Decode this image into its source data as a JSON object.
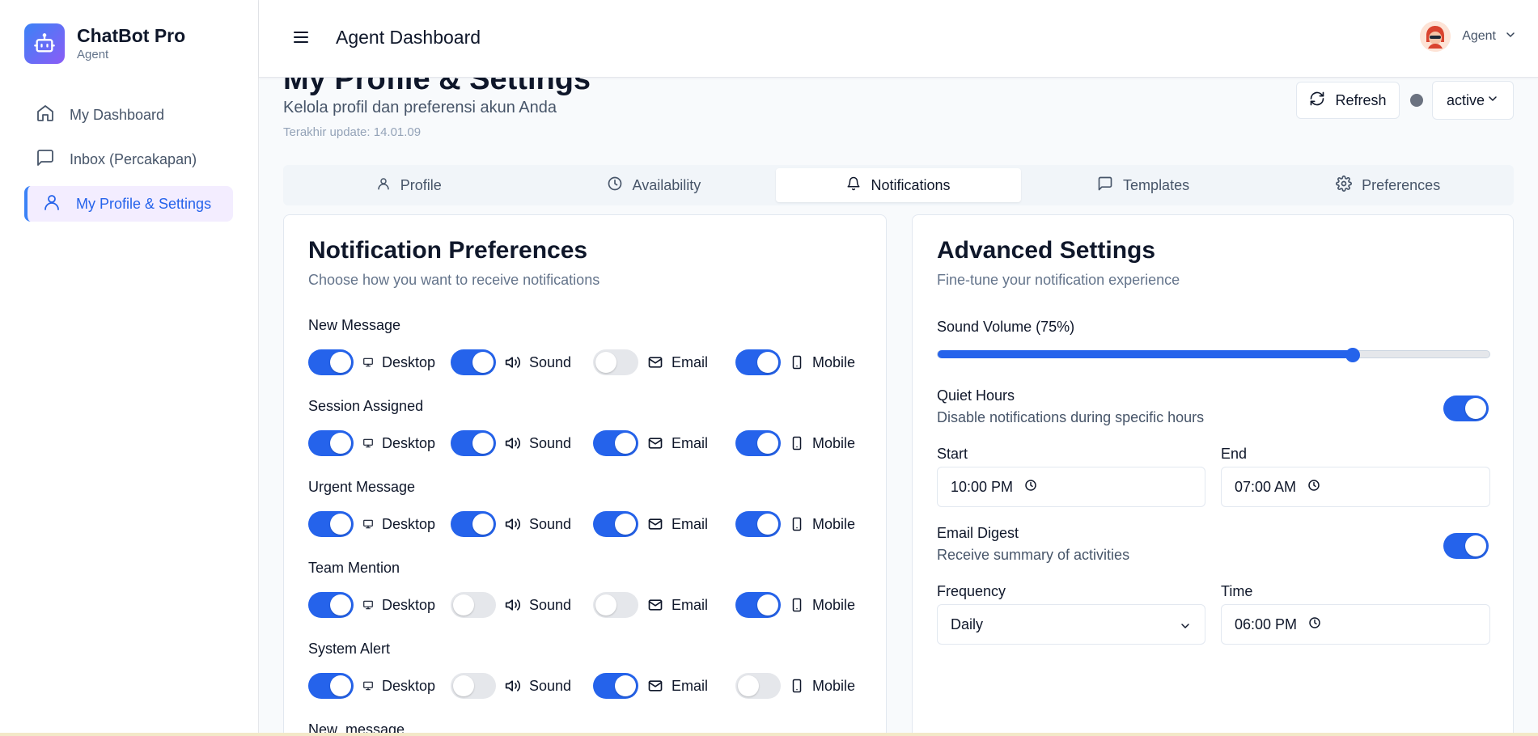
{
  "brand": {
    "name": "ChatBot Pro",
    "role": "Agent"
  },
  "sidebar": {
    "items": [
      {
        "label": "My Dashboard",
        "icon": "home-icon"
      },
      {
        "label": "Inbox (Percakapan)",
        "icon": "chat-bubble-icon"
      },
      {
        "label": "My Profile & Settings",
        "icon": "user-icon",
        "active": true
      }
    ]
  },
  "header": {
    "title": "Agent Dashboard",
    "user_name": "Agent"
  },
  "page": {
    "title": "My Profile & Settings",
    "subtitle": "Kelola profil dan preferensi akun Anda",
    "updated": "Terakhir update: 14.01.09",
    "refresh_label": "Refresh",
    "status_value": "active",
    "status_dot_color": "#6b7280"
  },
  "tabs": [
    {
      "label": "Profile",
      "icon": "user-icon"
    },
    {
      "label": "Availability",
      "icon": "clock-icon"
    },
    {
      "label": "Notifications",
      "icon": "bell-icon",
      "active": true
    },
    {
      "label": "Templates",
      "icon": "chat-bubble-icon"
    },
    {
      "label": "Preferences",
      "icon": "gear-icon"
    }
  ],
  "notifications": {
    "title": "Notification Preferences",
    "subtitle": "Choose how you want to receive notifications",
    "channels": {
      "desktop": "Desktop",
      "sound": "Sound",
      "email": "Email",
      "mobile": "Mobile"
    },
    "groups": [
      {
        "label": "New Message",
        "desktop": true,
        "sound": true,
        "email": false,
        "mobile": true
      },
      {
        "label": "Session Assigned",
        "desktop": true,
        "sound": true,
        "email": true,
        "mobile": true
      },
      {
        "label": "Urgent Message",
        "desktop": true,
        "sound": true,
        "email": true,
        "mobile": true
      },
      {
        "label": "Team Mention",
        "desktop": true,
        "sound": false,
        "email": false,
        "mobile": true
      },
      {
        "label": "System Alert",
        "desktop": true,
        "sound": false,
        "email": true,
        "mobile": false
      },
      {
        "label": "New_message"
      }
    ]
  },
  "advanced": {
    "title": "Advanced Settings",
    "subtitle": "Fine-tune your notification experience",
    "volume_label": "Sound Volume (75%)",
    "volume_value": 0.75,
    "quiet_hours": {
      "title": "Quiet Hours",
      "desc": "Disable notifications during specific hours",
      "enabled": true,
      "start_label": "Start",
      "start_value": "10:00 PM",
      "end_label": "End",
      "end_value": "07:00 AM"
    },
    "email_digest": {
      "title": "Email Digest",
      "desc": "Receive summary of activities",
      "enabled": true,
      "frequency_label": "Frequency",
      "frequency_value": "Daily",
      "time_label": "Time",
      "time_value": "06:00 PM"
    }
  },
  "colors": {
    "accent": "#2563eb",
    "toggle_off": "#e5e7eb"
  }
}
